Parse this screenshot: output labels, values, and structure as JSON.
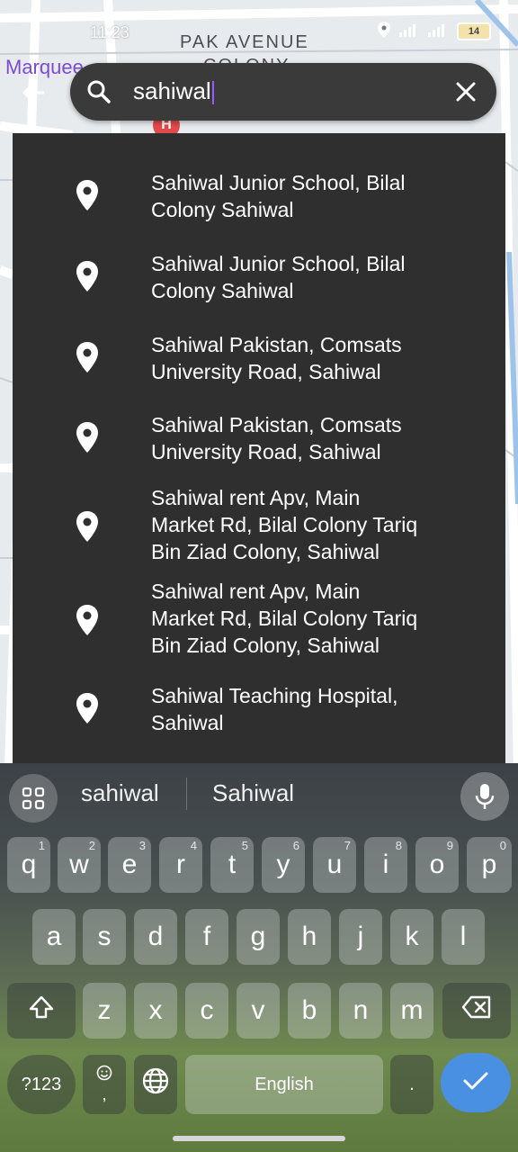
{
  "status_bar": {
    "time": "11:23",
    "battery": "14"
  },
  "map": {
    "labels": [
      "PAK AVENUE",
      "COLONY"
    ],
    "marquee": "Marquee",
    "hospital_marker": "H"
  },
  "search": {
    "query": "sahiwal"
  },
  "results": [
    {
      "line1": "Sahiwal Junior School, Bilal",
      "line2": "Colony Sahiwal",
      "line3": ""
    },
    {
      "line1": "Sahiwal Junior School, Bilal",
      "line2": "Colony Sahiwal",
      "line3": ""
    },
    {
      "line1": "Sahiwal Pakistan, Comsats",
      "line2": "University Road, Sahiwal",
      "line3": ""
    },
    {
      "line1": "Sahiwal Pakistan, Comsats",
      "line2": "University Road, Sahiwal",
      "line3": ""
    },
    {
      "line1": "Sahiwal rent Apv, Main",
      "line2": "Market Rd, Bilal Colony Tariq",
      "line3": "Bin Ziad Colony, Sahiwal"
    },
    {
      "line1": "Sahiwal rent Apv, Main",
      "line2": "Market Rd, Bilal Colony Tariq",
      "line3": "Bin Ziad Colony, Sahiwal"
    },
    {
      "line1": "Sahiwal Teaching Hospital,",
      "line2": "Sahiwal",
      "line3": ""
    }
  ],
  "keyboard": {
    "suggestions": [
      "sahiwal",
      "Sahiwal"
    ],
    "row1": [
      {
        "k": "q",
        "h": "1"
      },
      {
        "k": "w",
        "h": "2"
      },
      {
        "k": "e",
        "h": "3"
      },
      {
        "k": "r",
        "h": "4"
      },
      {
        "k": "t",
        "h": "5"
      },
      {
        "k": "y",
        "h": "6"
      },
      {
        "k": "u",
        "h": "7"
      },
      {
        "k": "i",
        "h": "8"
      },
      {
        "k": "o",
        "h": "9"
      },
      {
        "k": "p",
        "h": "0"
      }
    ],
    "row2": [
      "a",
      "s",
      "d",
      "f",
      "g",
      "h",
      "j",
      "k",
      "l"
    ],
    "row3": [
      "z",
      "x",
      "c",
      "v",
      "b",
      "n",
      "m"
    ],
    "symbols_label": "?123",
    "space_label": "English",
    "period_label": ".",
    "comma_label": ","
  },
  "colors": {
    "accent": "#4a90e2",
    "panel": "#2f2f2f",
    "searchbar": "#3a3a3a",
    "marquee": "#7b4bd6",
    "hospital": "#e04a4a"
  }
}
